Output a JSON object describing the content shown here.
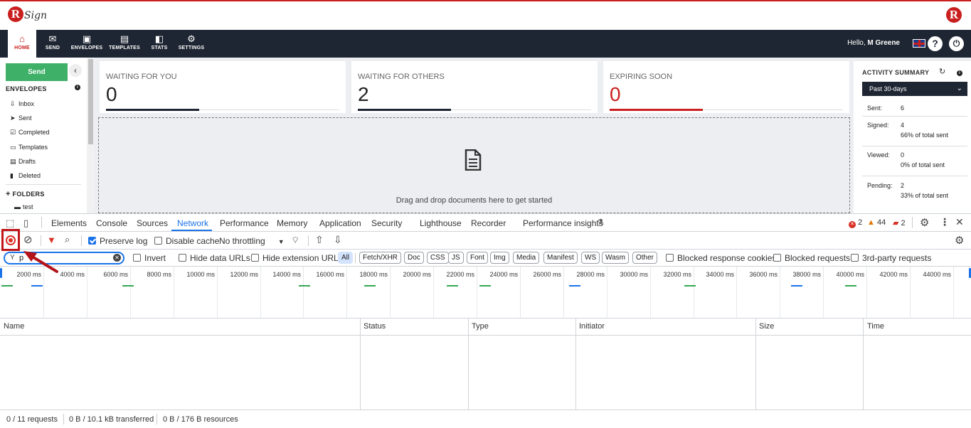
{
  "app": {
    "logo_letter": "R",
    "logo_word": "Sign",
    "nav": [
      {
        "label": "HOME",
        "icon": "home-icon"
      },
      {
        "label": "SEND",
        "icon": "envelope-icon"
      },
      {
        "label": "ENVELOPES",
        "icon": "inbox-icon"
      },
      {
        "label": "TEMPLATES",
        "icon": "template-icon"
      },
      {
        "label": "STATS",
        "icon": "briefcase-icon"
      },
      {
        "label": "SETTINGS",
        "icon": "gear-icon"
      }
    ],
    "greeting": "Hello,",
    "user_name": "M Greene",
    "help_symbol": "?",
    "power_symbol": "⏻"
  },
  "sidebar": {
    "send_label": "Send",
    "collapse_symbol": "‹",
    "envelopes_heading": "ENVELOPES",
    "info_symbol": "i",
    "items": [
      {
        "label": "Inbox",
        "icon": "inbox-icon"
      },
      {
        "label": "Sent",
        "icon": "paper-plane-icon"
      },
      {
        "label": "Completed",
        "icon": "check-square-icon"
      },
      {
        "label": "Templates",
        "icon": "window-icon"
      },
      {
        "label": "Drafts",
        "icon": "draft-icon"
      },
      {
        "label": "Deleted",
        "icon": "trash-icon"
      }
    ],
    "folders_heading": "FOLDERS",
    "folders_plus": "+",
    "folders": [
      {
        "label": "test",
        "icon": "folder-icon"
      }
    ]
  },
  "stats": [
    {
      "label": "WAITING FOR YOU",
      "value": "0",
      "fill": 0.4,
      "color": "#1f2633"
    },
    {
      "label": "WAITING FOR OTHERS",
      "value": "2",
      "fill": 0.4,
      "color": "#1f2633"
    },
    {
      "label": "EXPIRING SOON",
      "value": "0",
      "fill": 0.4,
      "color": "#c9201f"
    }
  ],
  "dropzone": {
    "text": "Drag and drop documents here to get started",
    "icon": "document-icon"
  },
  "activity": {
    "title": "ACTIVITY SUMMARY",
    "period": "Past 30-days",
    "rows": [
      {
        "key": "Sent:",
        "value": "6",
        "sub": ""
      },
      {
        "key": "Signed:",
        "value": "4",
        "sub": "66% of total sent"
      },
      {
        "key": "Viewed:",
        "value": "0",
        "sub": "0% of total sent"
      },
      {
        "key": "Pending:",
        "value": "2",
        "sub": "33% of total sent"
      }
    ]
  },
  "devtools": {
    "tabs": [
      "Elements",
      "Console",
      "Sources",
      "Network",
      "Performance",
      "Memory",
      "Application",
      "Security",
      "Lighthouse",
      "Recorder",
      "Performance insights"
    ],
    "active_tab": "Network",
    "errors": "2",
    "warnings": "44",
    "messages": "2",
    "toolbar": {
      "preserve_log": "Preserve log",
      "preserve_log_checked": true,
      "disable_cache": "Disable cache",
      "disable_cache_checked": false,
      "throttling": "No throttling"
    },
    "filter": {
      "value": "p",
      "invert": "Invert",
      "hide_data_urls": "Hide data URLs",
      "hide_extension_urls": "Hide extension URLs",
      "types": [
        "All",
        "Fetch/XHR",
        "Doc",
        "CSS",
        "JS",
        "Font",
        "Img",
        "Media",
        "Manifest",
        "WS",
        "Wasm",
        "Other"
      ],
      "active_type": "All",
      "blocked_cookies": "Blocked response cookies",
      "blocked_requests": "Blocked requests",
      "third_party": "3rd-party requests"
    },
    "timeline_ticks": [
      "2000 ms",
      "4000 ms",
      "6000 ms",
      "8000 ms",
      "10000 ms",
      "12000 ms",
      "14000 ms",
      "16000 ms",
      "18000 ms",
      "20000 ms",
      "22000 ms",
      "24000 ms",
      "26000 ms",
      "28000 ms",
      "30000 ms",
      "32000 ms",
      "34000 ms",
      "36000 ms",
      "38000 ms",
      "40000 ms",
      "42000 ms",
      "44000 ms"
    ],
    "columns": [
      "Name",
      "Status",
      "Type",
      "Initiator",
      "Size",
      "Time"
    ],
    "status": {
      "requests": "0 / 11 requests",
      "transferred": "0 B / 10.1 kB transferred",
      "resources": "0 B / 176 B resources"
    }
  }
}
